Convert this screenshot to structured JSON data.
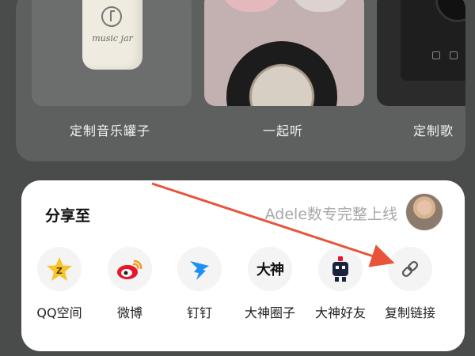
{
  "cards": [
    {
      "label": "定制音乐罐子"
    },
    {
      "label": "一起听"
    },
    {
      "label": "定制歌"
    }
  ],
  "jar_brand": "music jar",
  "share": {
    "title": "分享至",
    "promo": "Adele数专完整上线",
    "items": [
      {
        "label": "QQ空间",
        "icon": "qzone-star-icon"
      },
      {
        "label": "微博",
        "icon": "weibo-icon"
      },
      {
        "label": "钉钉",
        "icon": "dingtalk-icon"
      },
      {
        "label": "大神圈子",
        "icon": "dashen-circle-icon",
        "icon_text": "大神"
      },
      {
        "label": "大神好友",
        "icon": "dashen-friend-icon"
      },
      {
        "label": "复制链接",
        "icon": "link-icon"
      }
    ]
  },
  "colors": {
    "background": "#4a4c4b",
    "sheet": "#ffffff",
    "arrow": "#e8543a",
    "qzone": "#f7c52b",
    "weibo": "#e6162d",
    "dingtalk": "#1e8ff5"
  }
}
